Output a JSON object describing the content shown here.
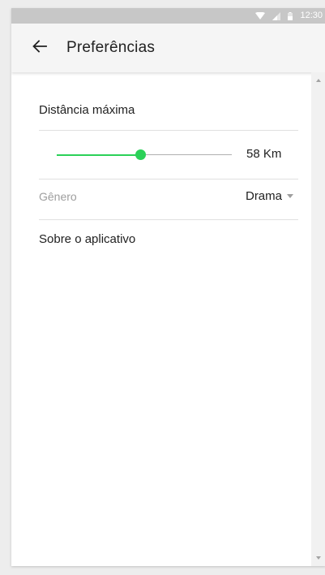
{
  "status_bar": {
    "time": "12:30",
    "icons": [
      "wifi-icon",
      "signal-icon",
      "battery-icon"
    ]
  },
  "app_bar": {
    "back_icon": "arrow-left-icon",
    "title": "Preferências"
  },
  "preferences": {
    "max_distance_label": "Distância máxima",
    "slider": {
      "value_label": "58 Km",
      "fraction": 0.46,
      "accent_color": "#2bd158"
    },
    "genre": {
      "label": "Gênero",
      "selected": "Drama",
      "dropdown_icon": "caret-down-icon"
    },
    "about_label": "Sobre o aplicativo"
  }
}
